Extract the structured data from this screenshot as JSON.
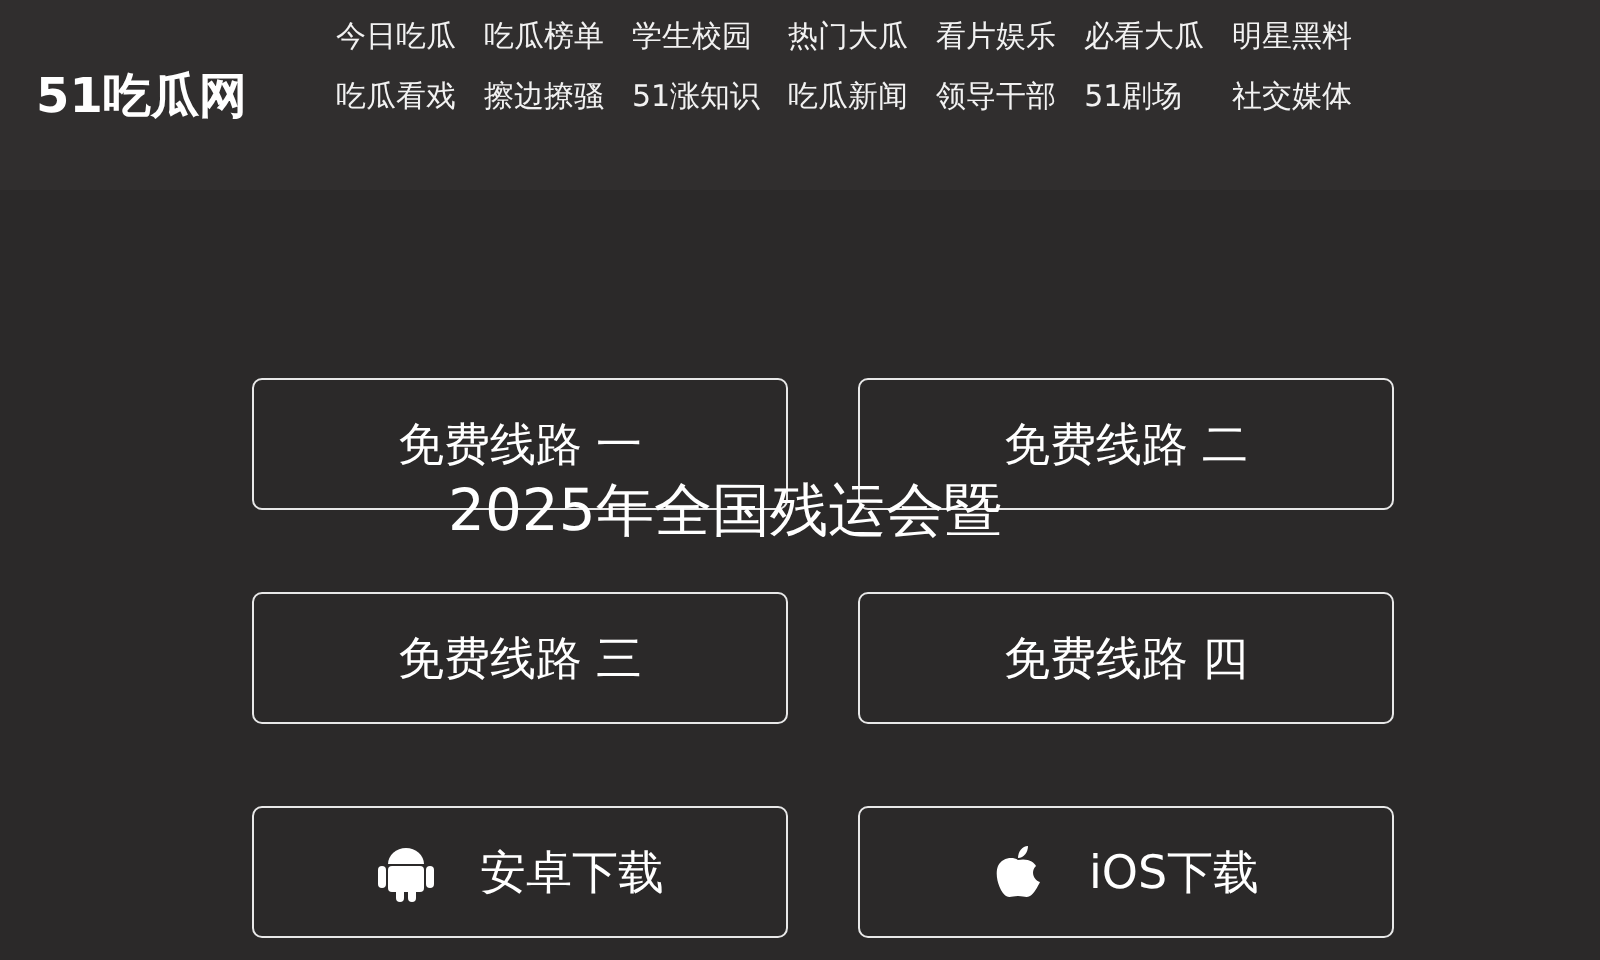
{
  "header": {
    "logo": "51吃瓜网",
    "nav": [
      "今日吃瓜",
      "吃瓜榜单",
      "学生校园",
      "热门大瓜",
      "看片娱乐",
      "必看大瓜",
      "明星黑料",
      "吃瓜看戏",
      "擦边撩骚",
      "51涨知识",
      "吃瓜新闻",
      "领导干部",
      "51剧场",
      "社交媒体"
    ]
  },
  "buttons": [
    {
      "label": "免费线路 一",
      "kind": "link"
    },
    {
      "label": "免费线路 二",
      "kind": "link"
    },
    {
      "label": "免费线路 三",
      "kind": "link"
    },
    {
      "label": "免费线路 四",
      "kind": "link"
    },
    {
      "label": "安卓下载",
      "kind": "android"
    },
    {
      "label": "iOS下载",
      "kind": "apple"
    }
  ],
  "overlay_text": "2025年全国残运会暨"
}
